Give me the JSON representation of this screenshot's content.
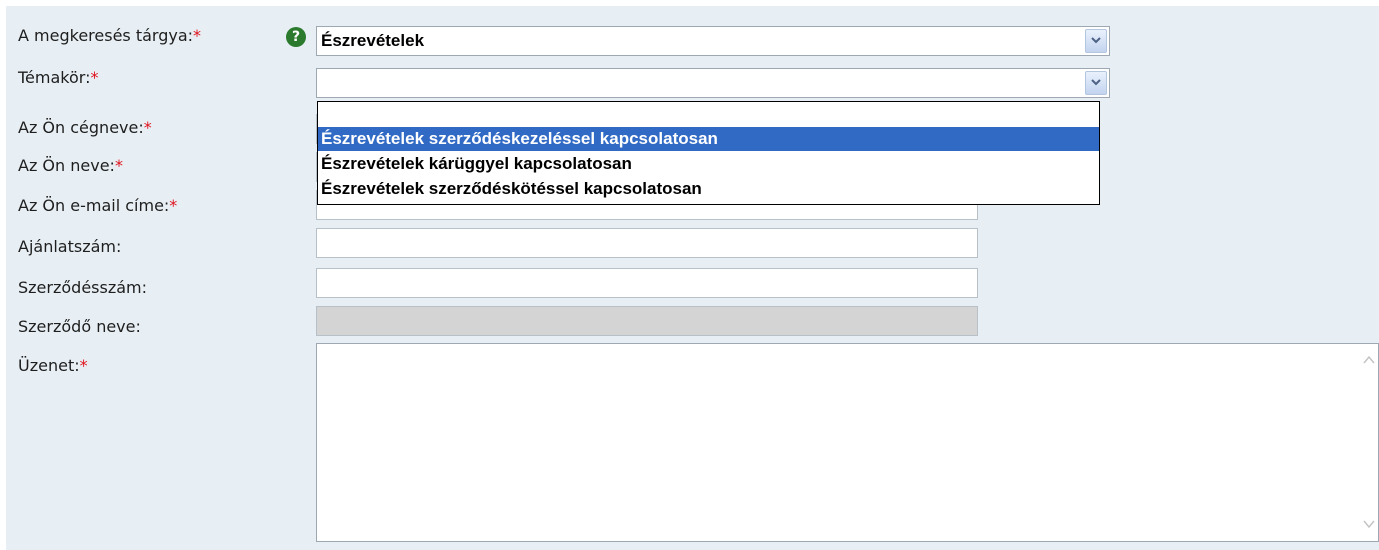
{
  "form": {
    "subject": {
      "label": "A megkeresés tárgya:",
      "required_mark": "*",
      "value": "Észrevételek",
      "help_icon": "question-circle-icon"
    },
    "topic": {
      "label": "Témakör:",
      "required_mark": "*",
      "value": "",
      "options": [
        "",
        "Észrevételek szerződéskezeléssel kapcsolatosan",
        "Észrevételek kárüggyel kapcsolatosan",
        "Észrevételek szerződéskötéssel kapcsolatosan"
      ],
      "highlighted_option": "Észrevételek szerződéskezeléssel kapcsolatosan"
    },
    "company": {
      "label": "Az Ön cégneve:",
      "required_mark": "*",
      "value": ""
    },
    "name": {
      "label": "Az Ön neve:",
      "required_mark": "*",
      "value": ""
    },
    "email": {
      "label": "Az Ön e-mail címe:",
      "required_mark": "*",
      "value": ""
    },
    "offer_number": {
      "label": "Ajánlatszám:",
      "value": ""
    },
    "contract_number": {
      "label": "Szerződésszám:",
      "value": ""
    },
    "contractor_name": {
      "label": "Szerződő neve:",
      "value": "",
      "disabled": true
    },
    "message": {
      "label": "Üzenet:",
      "required_mark": "*",
      "value": ""
    }
  },
  "colors": {
    "panel_background": "#e8eff4",
    "required_mark": "#e0121c",
    "selection_highlight": "#316ac5",
    "help_icon": "#2b7a2e",
    "disabled_field": "#d4d4d4"
  }
}
